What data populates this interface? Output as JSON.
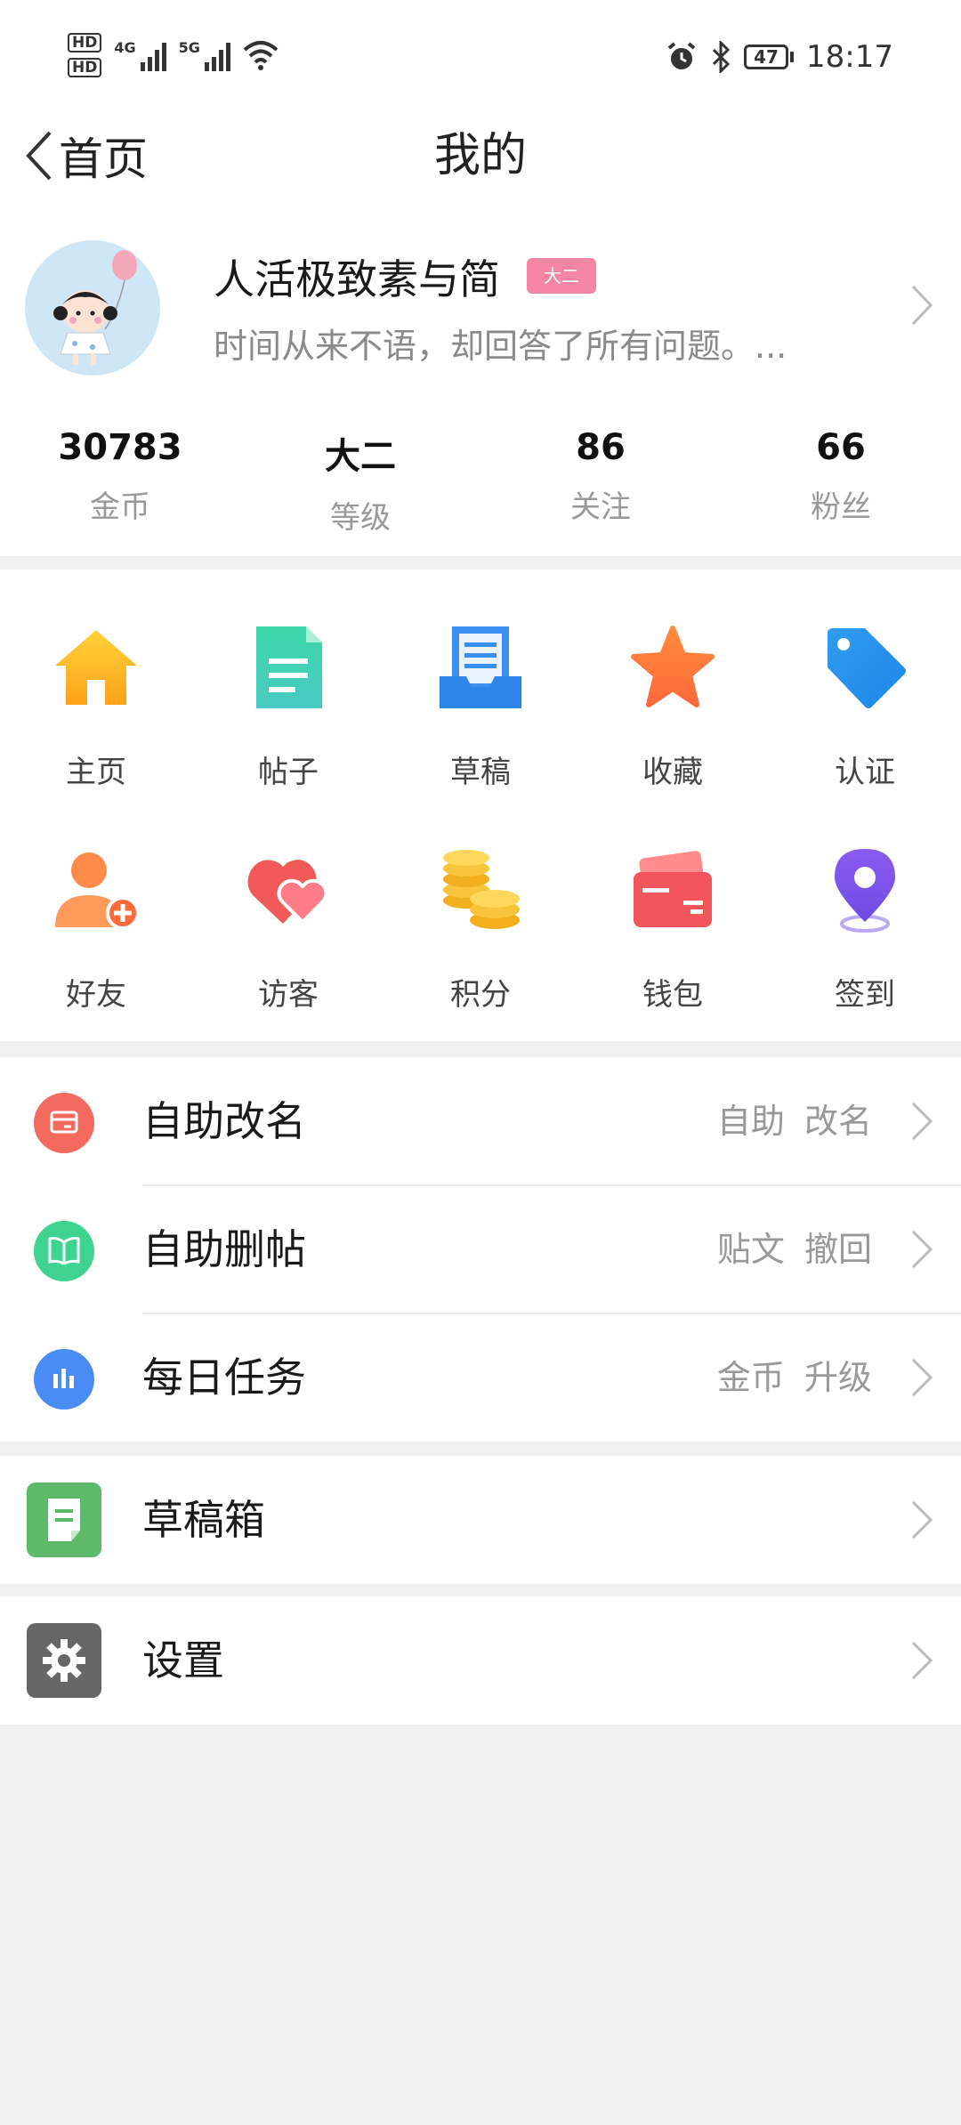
{
  "status_bar": {
    "hd1": "HD",
    "hd2": "HD",
    "net1": "4G",
    "net2": "5G",
    "battery": "47",
    "time": "18:17"
  },
  "nav": {
    "back_label": "首页",
    "title": "我的"
  },
  "profile": {
    "username": "人活极致素与简",
    "badge": "大二",
    "bio": "时间从来不语，却回答了所有问题。...",
    "stats": [
      {
        "value": "30783",
        "label": "金币"
      },
      {
        "value": "大二",
        "label": "等级"
      },
      {
        "value": "86",
        "label": "关注"
      },
      {
        "value": "66",
        "label": "粉丝"
      }
    ]
  },
  "grid": {
    "items": [
      {
        "label": "主页",
        "icon": "home-icon"
      },
      {
        "label": "帖子",
        "icon": "document-icon"
      },
      {
        "label": "草稿",
        "icon": "draft-tray-icon"
      },
      {
        "label": "收藏",
        "icon": "star-icon"
      },
      {
        "label": "认证",
        "icon": "tag-icon"
      },
      {
        "label": "好友",
        "icon": "add-friend-icon"
      },
      {
        "label": "访客",
        "icon": "hearts-icon"
      },
      {
        "label": "积分",
        "icon": "coins-icon"
      },
      {
        "label": "钱包",
        "icon": "wallet-icon"
      },
      {
        "label": "签到",
        "icon": "location-pin-icon"
      }
    ]
  },
  "list": {
    "items": [
      {
        "label": "自助改名",
        "right": "自助 改名",
        "color": "#f46a5e"
      },
      {
        "label": "自助删帖",
        "right": "贴文 撤回",
        "color": "#3ed38f"
      },
      {
        "label": "每日任务",
        "right": "金币 升级",
        "color": "#4a8cf5"
      }
    ]
  },
  "drafts_box": {
    "label": "草稿箱",
    "color": "#5cba6a"
  },
  "settings": {
    "label": "设置",
    "color": "#666666"
  }
}
